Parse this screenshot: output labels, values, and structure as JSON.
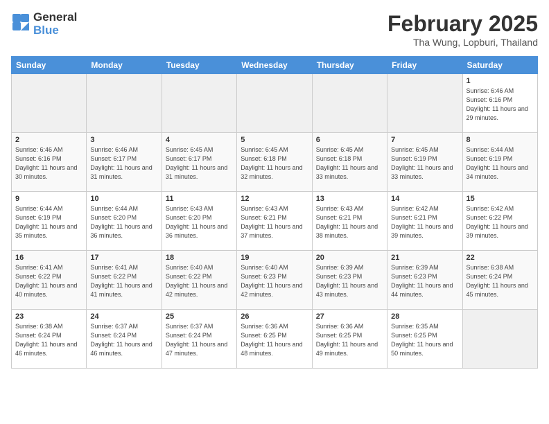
{
  "header": {
    "logo_general": "General",
    "logo_blue": "Blue",
    "title": "February 2025",
    "subtitle": "Tha Wung, Lopburi, Thailand"
  },
  "days_of_week": [
    "Sunday",
    "Monday",
    "Tuesday",
    "Wednesday",
    "Thursday",
    "Friday",
    "Saturday"
  ],
  "weeks": [
    [
      {
        "day": "",
        "sunrise": "",
        "sunset": "",
        "daylight": "",
        "empty": true
      },
      {
        "day": "",
        "sunrise": "",
        "sunset": "",
        "daylight": "",
        "empty": true
      },
      {
        "day": "",
        "sunrise": "",
        "sunset": "",
        "daylight": "",
        "empty": true
      },
      {
        "day": "",
        "sunrise": "",
        "sunset": "",
        "daylight": "",
        "empty": true
      },
      {
        "day": "",
        "sunrise": "",
        "sunset": "",
        "daylight": "",
        "empty": true
      },
      {
        "day": "",
        "sunrise": "",
        "sunset": "",
        "daylight": "",
        "empty": true
      },
      {
        "day": "1",
        "sunrise": "6:46 AM",
        "sunset": "6:16 PM",
        "daylight": "11 hours and 29 minutes.",
        "empty": false
      }
    ],
    [
      {
        "day": "2",
        "sunrise": "6:46 AM",
        "sunset": "6:16 PM",
        "daylight": "11 hours and 30 minutes.",
        "empty": false
      },
      {
        "day": "3",
        "sunrise": "6:46 AM",
        "sunset": "6:17 PM",
        "daylight": "11 hours and 31 minutes.",
        "empty": false
      },
      {
        "day": "4",
        "sunrise": "6:45 AM",
        "sunset": "6:17 PM",
        "daylight": "11 hours and 31 minutes.",
        "empty": false
      },
      {
        "day": "5",
        "sunrise": "6:45 AM",
        "sunset": "6:18 PM",
        "daylight": "11 hours and 32 minutes.",
        "empty": false
      },
      {
        "day": "6",
        "sunrise": "6:45 AM",
        "sunset": "6:18 PM",
        "daylight": "11 hours and 33 minutes.",
        "empty": false
      },
      {
        "day": "7",
        "sunrise": "6:45 AM",
        "sunset": "6:19 PM",
        "daylight": "11 hours and 33 minutes.",
        "empty": false
      },
      {
        "day": "8",
        "sunrise": "6:44 AM",
        "sunset": "6:19 PM",
        "daylight": "11 hours and 34 minutes.",
        "empty": false
      }
    ],
    [
      {
        "day": "9",
        "sunrise": "6:44 AM",
        "sunset": "6:19 PM",
        "daylight": "11 hours and 35 minutes.",
        "empty": false
      },
      {
        "day": "10",
        "sunrise": "6:44 AM",
        "sunset": "6:20 PM",
        "daylight": "11 hours and 36 minutes.",
        "empty": false
      },
      {
        "day": "11",
        "sunrise": "6:43 AM",
        "sunset": "6:20 PM",
        "daylight": "11 hours and 36 minutes.",
        "empty": false
      },
      {
        "day": "12",
        "sunrise": "6:43 AM",
        "sunset": "6:21 PM",
        "daylight": "11 hours and 37 minutes.",
        "empty": false
      },
      {
        "day": "13",
        "sunrise": "6:43 AM",
        "sunset": "6:21 PM",
        "daylight": "11 hours and 38 minutes.",
        "empty": false
      },
      {
        "day": "14",
        "sunrise": "6:42 AM",
        "sunset": "6:21 PM",
        "daylight": "11 hours and 39 minutes.",
        "empty": false
      },
      {
        "day": "15",
        "sunrise": "6:42 AM",
        "sunset": "6:22 PM",
        "daylight": "11 hours and 39 minutes.",
        "empty": false
      }
    ],
    [
      {
        "day": "16",
        "sunrise": "6:41 AM",
        "sunset": "6:22 PM",
        "daylight": "11 hours and 40 minutes.",
        "empty": false
      },
      {
        "day": "17",
        "sunrise": "6:41 AM",
        "sunset": "6:22 PM",
        "daylight": "11 hours and 41 minutes.",
        "empty": false
      },
      {
        "day": "18",
        "sunrise": "6:40 AM",
        "sunset": "6:22 PM",
        "daylight": "11 hours and 42 minutes.",
        "empty": false
      },
      {
        "day": "19",
        "sunrise": "6:40 AM",
        "sunset": "6:23 PM",
        "daylight": "11 hours and 42 minutes.",
        "empty": false
      },
      {
        "day": "20",
        "sunrise": "6:39 AM",
        "sunset": "6:23 PM",
        "daylight": "11 hours and 43 minutes.",
        "empty": false
      },
      {
        "day": "21",
        "sunrise": "6:39 AM",
        "sunset": "6:23 PM",
        "daylight": "11 hours and 44 minutes.",
        "empty": false
      },
      {
        "day": "22",
        "sunrise": "6:38 AM",
        "sunset": "6:24 PM",
        "daylight": "11 hours and 45 minutes.",
        "empty": false
      }
    ],
    [
      {
        "day": "23",
        "sunrise": "6:38 AM",
        "sunset": "6:24 PM",
        "daylight": "11 hours and 46 minutes.",
        "empty": false
      },
      {
        "day": "24",
        "sunrise": "6:37 AM",
        "sunset": "6:24 PM",
        "daylight": "11 hours and 46 minutes.",
        "empty": false
      },
      {
        "day": "25",
        "sunrise": "6:37 AM",
        "sunset": "6:24 PM",
        "daylight": "11 hours and 47 minutes.",
        "empty": false
      },
      {
        "day": "26",
        "sunrise": "6:36 AM",
        "sunset": "6:25 PM",
        "daylight": "11 hours and 48 minutes.",
        "empty": false
      },
      {
        "day": "27",
        "sunrise": "6:36 AM",
        "sunset": "6:25 PM",
        "daylight": "11 hours and 49 minutes.",
        "empty": false
      },
      {
        "day": "28",
        "sunrise": "6:35 AM",
        "sunset": "6:25 PM",
        "daylight": "11 hours and 50 minutes.",
        "empty": false
      },
      {
        "day": "",
        "sunrise": "",
        "sunset": "",
        "daylight": "",
        "empty": true
      }
    ]
  ]
}
